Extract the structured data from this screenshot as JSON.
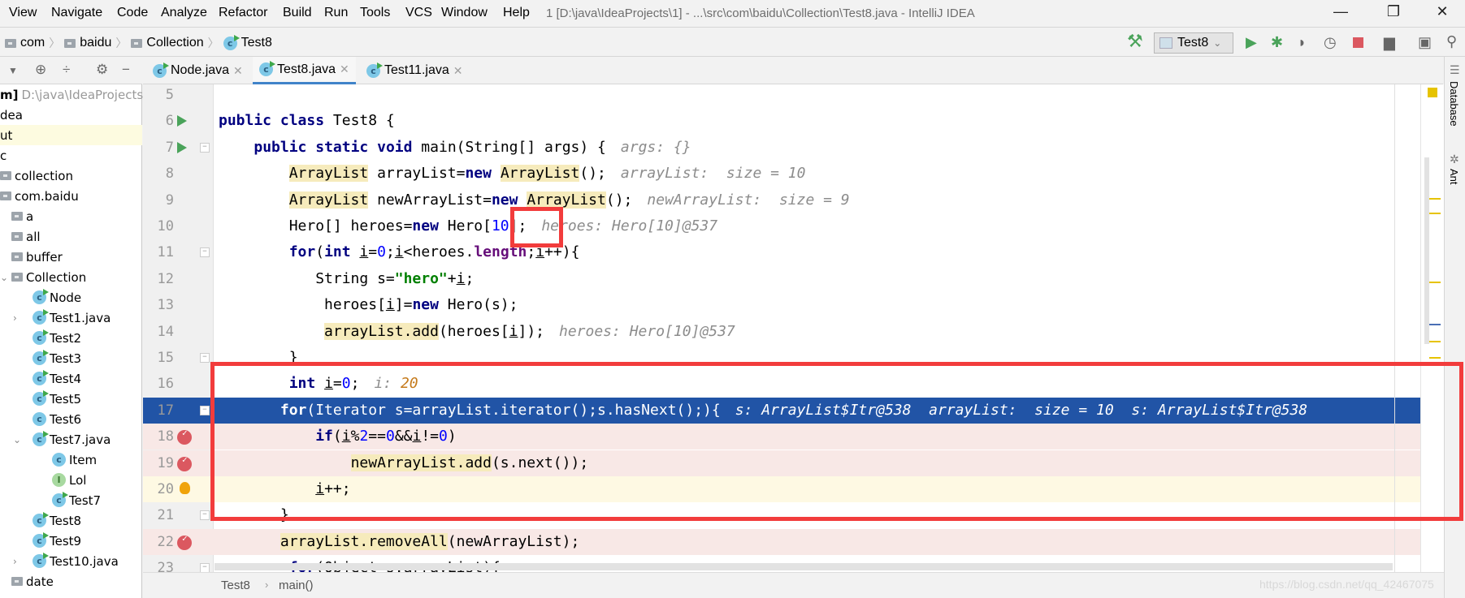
{
  "menu": {
    "items": [
      "View",
      "Navigate",
      "Code",
      "Analyze",
      "Refactor",
      "Build",
      "Run",
      "Tools",
      "VCS",
      "Window",
      "Help"
    ],
    "window_title": "1 [D:\\java\\IdeaProjects\\1] - ...\\src\\com\\baidu\\Collection\\Test8.java - IntelliJ IDEA",
    "window_controls": {
      "minimize": "—",
      "restore": "❐",
      "close": "✕"
    }
  },
  "breadcrumb": [
    "com",
    "baidu",
    "Collection",
    "Test8"
  ],
  "toolbar": {
    "run_config": "Test8",
    "icons": [
      "hammer-icon",
      "run-icon",
      "debug-icon",
      "coverage-icon",
      "profile-icon",
      "stop-icon",
      "project-structure-icon",
      "terminal-icon",
      "search-icon"
    ],
    "colors": {
      "run": "#4aa35a",
      "stop": "#db5860"
    }
  },
  "sidebar": {
    "header_icons": [
      "dropdown-icon",
      "locate-icon",
      "collapse-icon",
      "gear-icon",
      "hide-icon"
    ],
    "tree": [
      {
        "label": "m]",
        "extra": "D:\\java\\IdeaProjects",
        "indent": 0,
        "icon": "none"
      },
      {
        "label": "dea",
        "indent": 0,
        "icon": "none"
      },
      {
        "label": "ut",
        "indent": 0,
        "icon": "none",
        "selected": true
      },
      {
        "label": "c",
        "indent": 0,
        "icon": "none"
      },
      {
        "label": "collection",
        "indent": 0,
        "icon": "folder"
      },
      {
        "label": "com.baidu",
        "indent": 0,
        "icon": "folder"
      },
      {
        "label": "a",
        "indent": 1,
        "icon": "folder"
      },
      {
        "label": "all",
        "indent": 1,
        "icon": "folder"
      },
      {
        "label": "buffer",
        "indent": 1,
        "icon": "folder"
      },
      {
        "label": "Collection",
        "indent": 1,
        "icon": "folder",
        "arrow": "expanded"
      },
      {
        "label": "Node",
        "indent": 2,
        "icon": "class-run"
      },
      {
        "label": "Test1.java",
        "indent": 2,
        "icon": "class-run",
        "arrow": "collapsed"
      },
      {
        "label": "Test2",
        "indent": 2,
        "icon": "class-run"
      },
      {
        "label": "Test3",
        "indent": 2,
        "icon": "class-run"
      },
      {
        "label": "Test4",
        "indent": 2,
        "icon": "class-run"
      },
      {
        "label": "Test5",
        "indent": 2,
        "icon": "class-run"
      },
      {
        "label": "Test6",
        "indent": 2,
        "icon": "class"
      },
      {
        "label": "Test7.java",
        "indent": 2,
        "icon": "class-run",
        "arrow": "expanded"
      },
      {
        "label": "Item",
        "indent": 3,
        "icon": "class"
      },
      {
        "label": "Lol",
        "indent": 3,
        "icon": "interface"
      },
      {
        "label": "Test7",
        "indent": 3,
        "icon": "class-run"
      },
      {
        "label": "Test8",
        "indent": 2,
        "icon": "class-run"
      },
      {
        "label": "Test9",
        "indent": 2,
        "icon": "class-run"
      },
      {
        "label": "Test10.java",
        "indent": 2,
        "icon": "class-run",
        "arrow": "collapsed"
      },
      {
        "label": "date",
        "indent": 1,
        "icon": "folder"
      }
    ]
  },
  "tabs": [
    {
      "label": "Node.java",
      "active": false
    },
    {
      "label": "Test8.java",
      "active": true
    },
    {
      "label": "Test11.java",
      "active": false
    }
  ],
  "editor": {
    "lines": [
      {
        "num": "5",
        "tokens": []
      },
      {
        "num": "6",
        "gutter": "run",
        "tokens": [
          [
            "public",
            "k"
          ],
          [
            " "
          ],
          [
            "class",
            "k"
          ],
          [
            " Test8 {"
          ]
        ]
      },
      {
        "num": "7",
        "gutter": "run",
        "fold": true,
        "tokens": [
          [
            "    "
          ],
          [
            "public",
            "k"
          ],
          [
            " "
          ],
          [
            "static",
            "k"
          ],
          [
            " "
          ],
          [
            "void",
            "k"
          ],
          [
            " main(String[] args) {"
          ]
        ],
        "hint": "args: {}"
      },
      {
        "num": "8",
        "tokens": [
          [
            "        "
          ],
          [
            "ArrayList",
            "y"
          ],
          [
            " arrayList="
          ],
          [
            "new",
            "k"
          ],
          [
            " "
          ],
          [
            "ArrayList",
            "y"
          ],
          [
            "();"
          ]
        ],
        "hint": "arrayList:  size = 10"
      },
      {
        "num": "9",
        "tokens": [
          [
            "        "
          ],
          [
            "ArrayList",
            "y"
          ],
          [
            " newArrayList="
          ],
          [
            "new",
            "k"
          ],
          [
            " "
          ],
          [
            "ArrayList",
            "y"
          ],
          [
            "();"
          ]
        ],
        "hint": "newArrayList:  size = 9"
      },
      {
        "num": "10",
        "tokens": [
          [
            "        Hero[] heroes="
          ],
          [
            "new",
            "k"
          ],
          [
            " Hero["
          ],
          [
            "10",
            "n"
          ],
          [
            "];"
          ]
        ],
        "hint": "heroes: Hero[10]@537"
      },
      {
        "num": "11",
        "fold": true,
        "tokens": [
          [
            "        "
          ],
          [
            "for",
            "k"
          ],
          [
            "("
          ],
          [
            "int",
            "k"
          ],
          [
            " "
          ],
          [
            "i",
            "u"
          ],
          [
            "="
          ],
          [
            "0",
            "n"
          ],
          [
            ";"
          ],
          [
            "i",
            "u"
          ],
          [
            "<heroes."
          ],
          [
            "length",
            "f"
          ],
          [
            ";"
          ],
          [
            "i",
            "u"
          ],
          [
            "++){"
          ]
        ]
      },
      {
        "num": "12",
        "tokens": [
          [
            "           String s="
          ],
          [
            "\"hero\"",
            "s"
          ],
          [
            "+"
          ],
          [
            "i",
            "u"
          ],
          [
            ";"
          ]
        ]
      },
      {
        "num": "13",
        "tokens": [
          [
            "            heroes["
          ],
          [
            "i",
            "u"
          ],
          [
            "]="
          ],
          [
            "new",
            "k"
          ],
          [
            " Hero(s);"
          ]
        ]
      },
      {
        "num": "14",
        "tokens": [
          [
            "            "
          ],
          [
            "arrayList.add",
            "y"
          ],
          [
            "(heroes["
          ],
          [
            "i",
            "u"
          ],
          [
            "]);"
          ]
        ],
        "hint": "heroes: Hero[10]@537"
      },
      {
        "num": "15",
        "fold": true,
        "tokens": [
          [
            "        }"
          ]
        ]
      },
      {
        "num": "16",
        "tokens": [
          [
            "        "
          ],
          [
            "int",
            "k"
          ],
          [
            " "
          ],
          [
            "i",
            "u"
          ],
          [
            "="
          ],
          [
            "0",
            "n"
          ],
          [
            ";"
          ]
        ],
        "hint": "i: ",
        "hint_value": "20"
      },
      {
        "num": "17",
        "state": "execution-point",
        "fold": true,
        "tokens": [
          [
            "       "
          ],
          [
            "for",
            "k"
          ],
          [
            "(Iterator s=arrayList.iterator();s.hasNext();){"
          ]
        ],
        "hint": "s: ArrayList$Itr@538  arrayList:  size = 10  s: ArrayList$Itr@538"
      },
      {
        "num": "18",
        "state": "breakpoint",
        "gutter": "breakpoint",
        "tokens": [
          [
            "           "
          ],
          [
            "if",
            "k"
          ],
          [
            "("
          ],
          [
            "i",
            "u"
          ],
          [
            "%"
          ],
          [
            "2",
            "n"
          ],
          [
            "=="
          ],
          [
            "0",
            "n"
          ],
          [
            "&&"
          ],
          [
            "i",
            "u"
          ],
          [
            "!="
          ],
          [
            "0",
            "n"
          ],
          [
            ")"
          ]
        ]
      },
      {
        "num": "19",
        "state": "breakpoint",
        "gutter": "breakpoint",
        "tokens": [
          [
            "               "
          ],
          [
            "newArrayList.add",
            "y"
          ],
          [
            "(s.next());"
          ]
        ]
      },
      {
        "num": "20",
        "state": "caret",
        "gutter": "bulb",
        "tokens": [
          [
            "           "
          ],
          [
            "i",
            "u"
          ],
          [
            "++;"
          ]
        ]
      },
      {
        "num": "21",
        "fold": true,
        "tokens": [
          [
            "       }"
          ]
        ]
      },
      {
        "num": "22",
        "state": "breakpoint",
        "gutter": "breakpoint",
        "tokens": [
          [
            "       "
          ],
          [
            "arrayList.removeAll",
            "y"
          ],
          [
            "(newArrayList);"
          ]
        ]
      },
      {
        "num": "23",
        "fold": true,
        "tokens": [
          [
            "        "
          ],
          [
            "for",
            "k"
          ],
          [
            "(Object s:arrayList){"
          ]
        ]
      }
    ]
  },
  "status_breadcrumb": [
    "Test8",
    "main()"
  ],
  "tool_windows": [
    "Database",
    "Ant"
  ],
  "watermark": "https://blog.csdn.net/qq_42467075"
}
